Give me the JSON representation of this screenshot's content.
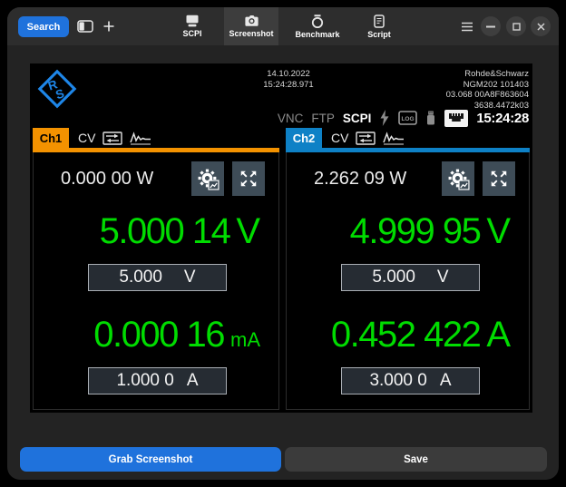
{
  "colors": {
    "accent_blue": "#1f72dc",
    "ch1_accent": "#f39200",
    "ch2_accent": "#0e81c6",
    "reading_green": "#00dc00",
    "tab_active_bg": "#3d3d3d",
    "panel_button_bg": "#3e4c57"
  },
  "titlebar": {
    "search_label": "Search",
    "tabs": [
      {
        "label": "SCPI"
      },
      {
        "label": "Screenshot",
        "active": true
      },
      {
        "label": "Benchmark"
      },
      {
        "label": "Script"
      }
    ]
  },
  "instrument": {
    "header": {
      "date": "14.10.2022",
      "time": "15:24:28.971",
      "brand": "Rohde&Schwarz",
      "model": "NGM202 101403",
      "serial": "03.068 00A8F863604",
      "part_number": "3638.4472k03"
    },
    "status": {
      "vnc": "VNC",
      "ftp": "FTP",
      "scpi": "SCPI",
      "log_label": "LOG",
      "clock": "15:24:28"
    },
    "channels": [
      {
        "name": "Ch1",
        "mode": "CV",
        "accent": "#f39200",
        "tab_text": "#000000",
        "power": "0.000 00 W",
        "voltage": "5.000 14",
        "voltage_unit": "V",
        "voltage_set": "5.000",
        "voltage_set_unit": "V",
        "current": "0.000 16",
        "current_unit": "mA",
        "current_unit_small": true,
        "current_set": "1.000 0",
        "current_set_unit": "A"
      },
      {
        "name": "Ch2",
        "mode": "CV",
        "accent": "#0e81c6",
        "tab_text": "#ffffff",
        "power": "2.262 09 W",
        "voltage": "4.999 95",
        "voltage_unit": "V",
        "voltage_set": "5.000",
        "voltage_set_unit": "V",
        "current": "0.452 422",
        "current_unit": "A",
        "current_unit_small": false,
        "current_set": "3.000 0",
        "current_set_unit": "A"
      }
    ]
  },
  "footer": {
    "grab_label": "Grab Screenshot",
    "save_label": "Save"
  }
}
